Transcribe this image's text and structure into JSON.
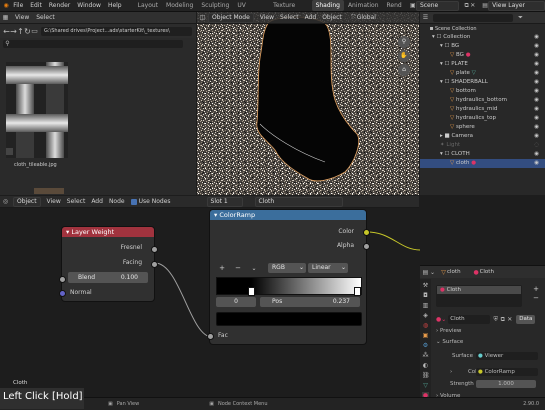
{
  "topbar": {
    "menus": [
      "File",
      "Edit",
      "Render",
      "Window",
      "Help"
    ],
    "workspaces": [
      "Layout",
      "Modeling",
      "Sculpting",
      "UV Editing",
      "Texture Paint",
      "Shading",
      "Animation",
      "Rend"
    ],
    "active_workspace": "Shading",
    "scene": "Scene",
    "view_layer": "View Layer"
  },
  "file_browser": {
    "menus": [
      "View",
      "Select"
    ],
    "path": "G:\\Shared drives\\Project...ads\\starterKit\\_textures\\",
    "file_name": "cloth_tileable.jpg"
  },
  "viewport": {
    "mode": "Object Mode",
    "menus": [
      "View",
      "Select",
      "Add",
      "Object"
    ],
    "orientation": "Global"
  },
  "outliner": {
    "header": "Scene Collection",
    "items": [
      {
        "label": "Collection",
        "indent": 0
      },
      {
        "label": "BG",
        "indent": 1
      },
      {
        "label": "BG",
        "indent": 2
      },
      {
        "label": "PLATE",
        "indent": 1
      },
      {
        "label": "plate",
        "indent": 2
      },
      {
        "label": "SHADERBALL",
        "indent": 1
      },
      {
        "label": "bottom",
        "indent": 2
      },
      {
        "label": "hydraulics_bottom",
        "indent": 2
      },
      {
        "label": "hydraulics_mid",
        "indent": 2
      },
      {
        "label": "hydraulics_top",
        "indent": 2
      },
      {
        "label": "sphere",
        "indent": 2
      },
      {
        "label": "Camera",
        "indent": 1
      },
      {
        "label": "Light",
        "indent": 1
      },
      {
        "label": "CLOTH",
        "indent": 1
      },
      {
        "label": "cloth",
        "indent": 2
      }
    ]
  },
  "node_editor": {
    "editor_menus": [
      "Object",
      "View",
      "Select",
      "Add",
      "Node"
    ],
    "use_nodes": "Use Nodes",
    "slot": "Slot 1",
    "material": "Cloth",
    "label_bottom_left": "Cloth",
    "layer_weight": {
      "title": "Layer Weight",
      "out_fresnel": "Fresnel",
      "out_facing": "Facing",
      "blend_label": "Blend",
      "blend_value": "0.100",
      "normal": "Normal"
    },
    "color_ramp": {
      "title": "ColorRamp",
      "out_color": "Color",
      "out_alpha": "Alpha",
      "add": "+",
      "remove": "−",
      "mode": "RGB",
      "interpolation": "Linear",
      "stop_index": "0",
      "pos_label": "Pos",
      "pos_value": "0.237",
      "in_fac": "Fac"
    }
  },
  "properties": {
    "object": "cloth",
    "material_slot_name": "Cloth",
    "material_name": "Cloth",
    "data_label": "Data",
    "preview": "Preview",
    "surface_section": "Surface",
    "surface_label": "Surface",
    "surface_value": "Viewer",
    "color_label": "Color",
    "color_value": "ColorRamp",
    "strength_label": "Strength",
    "strength_value": "1.000",
    "volume": "Volume"
  },
  "statusbar": {
    "hint": "Left Click [Hold]",
    "pan": "Pan View",
    "context": "Node Context Menu",
    "version": "2.90.0"
  },
  "colors": {
    "layer_weight_header": "#a1333e",
    "color_ramp_header": "#3b6e9c",
    "active_tab": "#3d3d3d",
    "socket_gray": "#a0a0a0",
    "socket_yellow": "#c7c729",
    "socket_purple": "#6363c7"
  }
}
